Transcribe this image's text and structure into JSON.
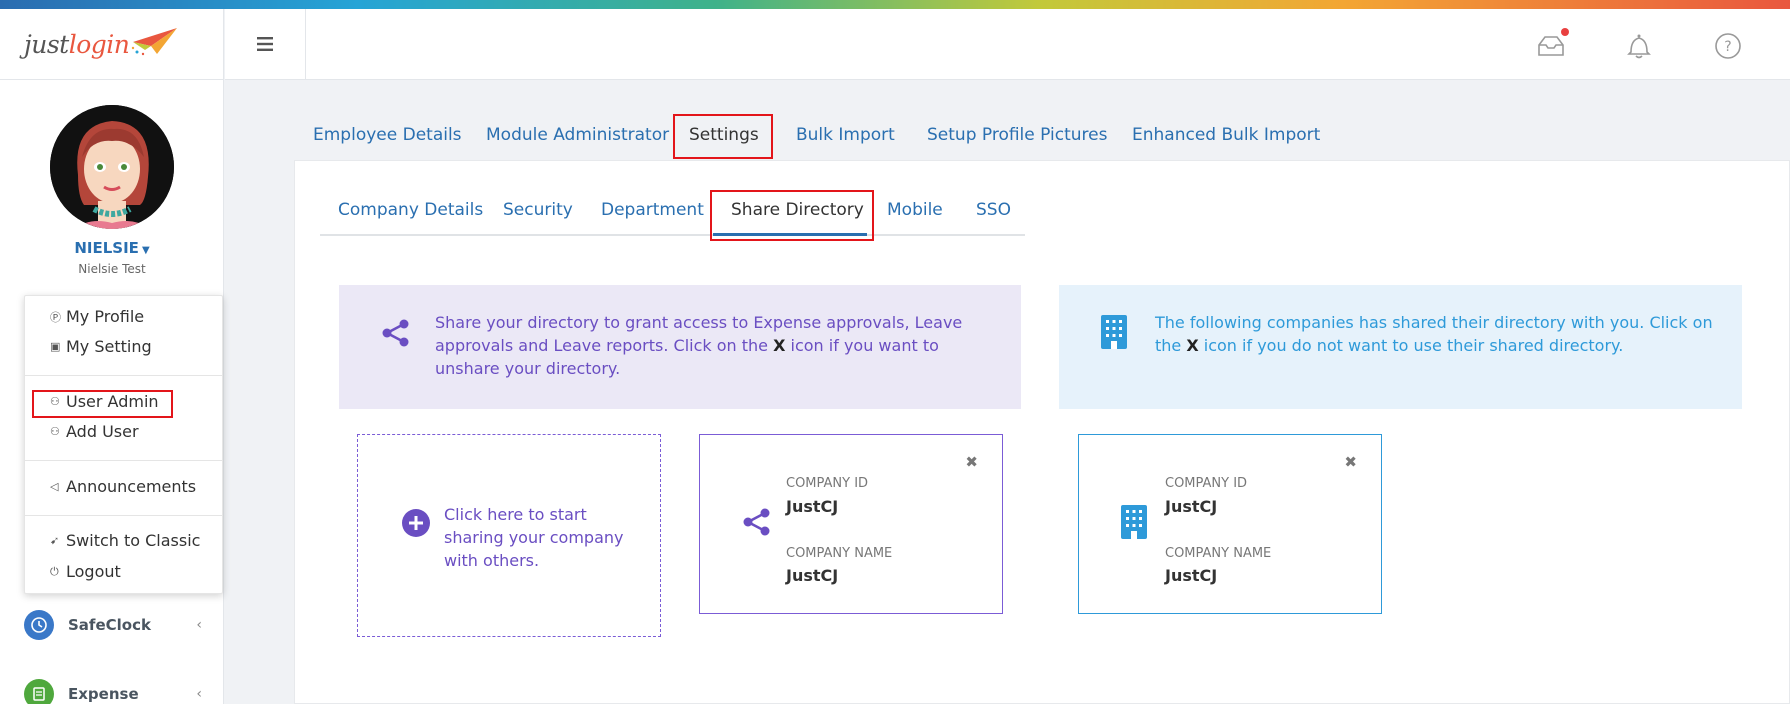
{
  "app": {
    "logo_part1": "just",
    "logo_part2": "login"
  },
  "colors": {
    "primary": "#2a6fb0",
    "purple": "#6a4ec2",
    "blue": "#2e9ad9",
    "highlight_red": "#e3151a"
  },
  "user": {
    "name": "NIELSIE",
    "subtitle": "Nielsie Test"
  },
  "dropdown": {
    "items": [
      {
        "label": "My Profile",
        "icon": "profile-icon"
      },
      {
        "label": "My Setting",
        "icon": "setting-icon"
      },
      {
        "label": "User Admin",
        "icon": "user-admin-icon"
      },
      {
        "label": "Add User",
        "icon": "add-user-icon"
      },
      {
        "label": "Announcements",
        "icon": "megaphone-icon"
      },
      {
        "label": "Switch to Classic",
        "icon": "paper-plane-icon"
      },
      {
        "label": "Logout",
        "icon": "power-icon"
      }
    ]
  },
  "nav": {
    "items": [
      {
        "label": "SafeClock",
        "icon": "clock-icon",
        "color": "#3a78c8"
      },
      {
        "label": "Expense",
        "icon": "receipt-icon",
        "color": "#4fa83d"
      }
    ]
  },
  "topbar": {
    "icons": [
      "menu-icon",
      "inbox-icon",
      "bell-icon",
      "help-icon"
    ]
  },
  "main_tabs": [
    {
      "label": "Employee Details"
    },
    {
      "label": "Module Administrator"
    },
    {
      "label": "Settings"
    },
    {
      "label": "Bulk Import"
    },
    {
      "label": "Setup Profile Pictures"
    },
    {
      "label": "Enhanced Bulk Import"
    }
  ],
  "settings_tabs": [
    {
      "label": "Company Details"
    },
    {
      "label": "Security"
    },
    {
      "label": "Department"
    },
    {
      "label": "Share Directory"
    },
    {
      "label": "Mobile"
    },
    {
      "label": "SSO"
    }
  ],
  "share_info": {
    "text_a": "Share your directory to grant access to Expense approvals, Leave approvals and Leave reports. Click on the ",
    "x": "X",
    "text_b": " icon if you want to unshare your directory."
  },
  "shared_info": {
    "text_a": "The following companies has shared their directory with you. Click on the ",
    "x": "X",
    "text_b": " icon if you do not want to use their shared directory."
  },
  "add_card": {
    "text": "Click here to start sharing your company with others."
  },
  "shared_cards": [
    {
      "id_label": "COMPANY ID",
      "id_value": "JustCJ",
      "name_label": "COMPANY NAME",
      "name_value": "JustCJ"
    },
    {
      "id_label": "COMPANY ID",
      "id_value": "JustCJ",
      "name_label": "COMPANY NAME",
      "name_value": "JustCJ"
    }
  ]
}
